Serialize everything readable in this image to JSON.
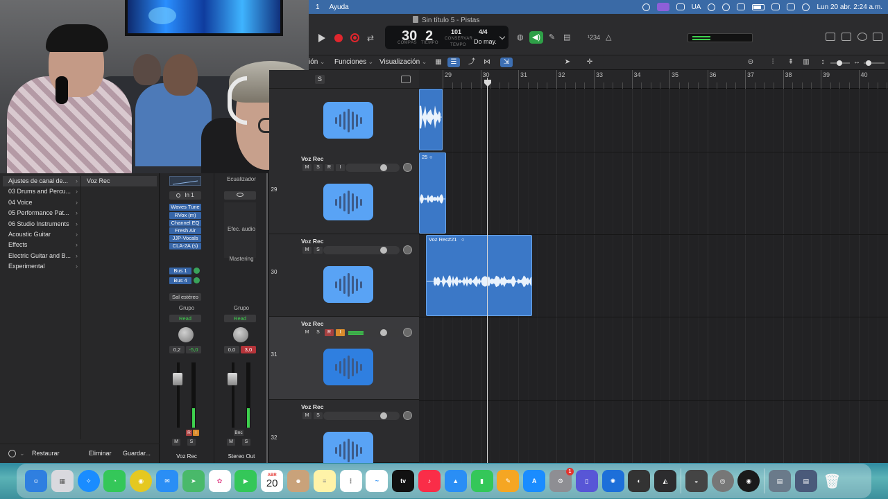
{
  "menubar": {
    "partial_item": "1",
    "help": "Ayuda",
    "region": "UA",
    "datetime": "Lun 20 abr.  2:24 a.m."
  },
  "window": {
    "title": "Sin título 5 - Pistas"
  },
  "lcd": {
    "bar": "30",
    "beat": "2",
    "bar_label": "COMPÁS",
    "beat_label": "TIEMPO",
    "tempo": "101",
    "tempo_mode": "CONSERVAR",
    "tempo_label": "TEMPO",
    "signature": "4/4",
    "key": "Do may."
  },
  "toolbar": {
    "count_in": "¹234"
  },
  "toolbar2": {
    "edit_menu_partial": "ión",
    "functions": "Funciones",
    "view": "Visualización"
  },
  "library": {
    "items": [
      {
        "label": "Ajustes de canal de..."
      },
      {
        "label": "03 Drums and Percu..."
      },
      {
        "label": "04 Voice"
      },
      {
        "label": "05 Performance Pat..."
      },
      {
        "label": "06 Studio Instruments"
      },
      {
        "label": "Acoustic Guitar"
      },
      {
        "label": "Effects"
      },
      {
        "label": "Electric Guitar and B..."
      },
      {
        "label": "Experimental"
      }
    ],
    "selected_patch": "Voz Rec",
    "restore": "Restaurar",
    "delete": "Eliminar",
    "save": "Guardar..."
  },
  "strip1": {
    "input": "In 1",
    "plugins": [
      "Waves Tune",
      "RVox (m)",
      "Channel EQ",
      "Fresh Air",
      "JJP-Vocals",
      "CLA-2A (s)"
    ],
    "sends": [
      "Bus 1",
      "Bus 4"
    ],
    "output": "Sal estéreo",
    "group": "Grupo",
    "automation": "Read",
    "pan_value": "0,2",
    "volume": "-5,0",
    "name": "Voz Rec"
  },
  "strip2": {
    "eq": "Ecualizador",
    "audio_fx": "Efec. audio",
    "mastering": "Mastering",
    "group": "Grupo",
    "automation": "Read",
    "pan_value": "0,0",
    "volume": "3,0",
    "bounce": "Bnc",
    "name": "Stereo Out"
  },
  "track_header": {
    "solo": "S"
  },
  "tracks": [
    {
      "number": "",
      "name": ""
    },
    {
      "number": "29",
      "name": "Voz Rec"
    },
    {
      "number": "30",
      "name": "Voz Rec"
    },
    {
      "number": "31",
      "name": "Voz Rec"
    },
    {
      "number": "32",
      "name": "Voz Rec"
    }
  ],
  "buttons": {
    "mute": "M",
    "solo": "S",
    "rec": "R",
    "input": "I"
  },
  "ruler": {
    "bars": [
      "29",
      "30",
      "31",
      "32",
      "33",
      "34",
      "35",
      "36",
      "37",
      "38",
      "39",
      "40"
    ]
  },
  "regions": [
    {
      "name": ""
    },
    {
      "name": "25"
    },
    {
      "name": "Voz Rec#21"
    }
  ],
  "dock": {
    "calendar_month": "ABR",
    "calendar_day": "20",
    "settings_badge": "1"
  },
  "colors": {
    "accent": "#3766a8",
    "record": "#e0262d",
    "meter": "#3ed04e",
    "region": "#3b78c7"
  }
}
